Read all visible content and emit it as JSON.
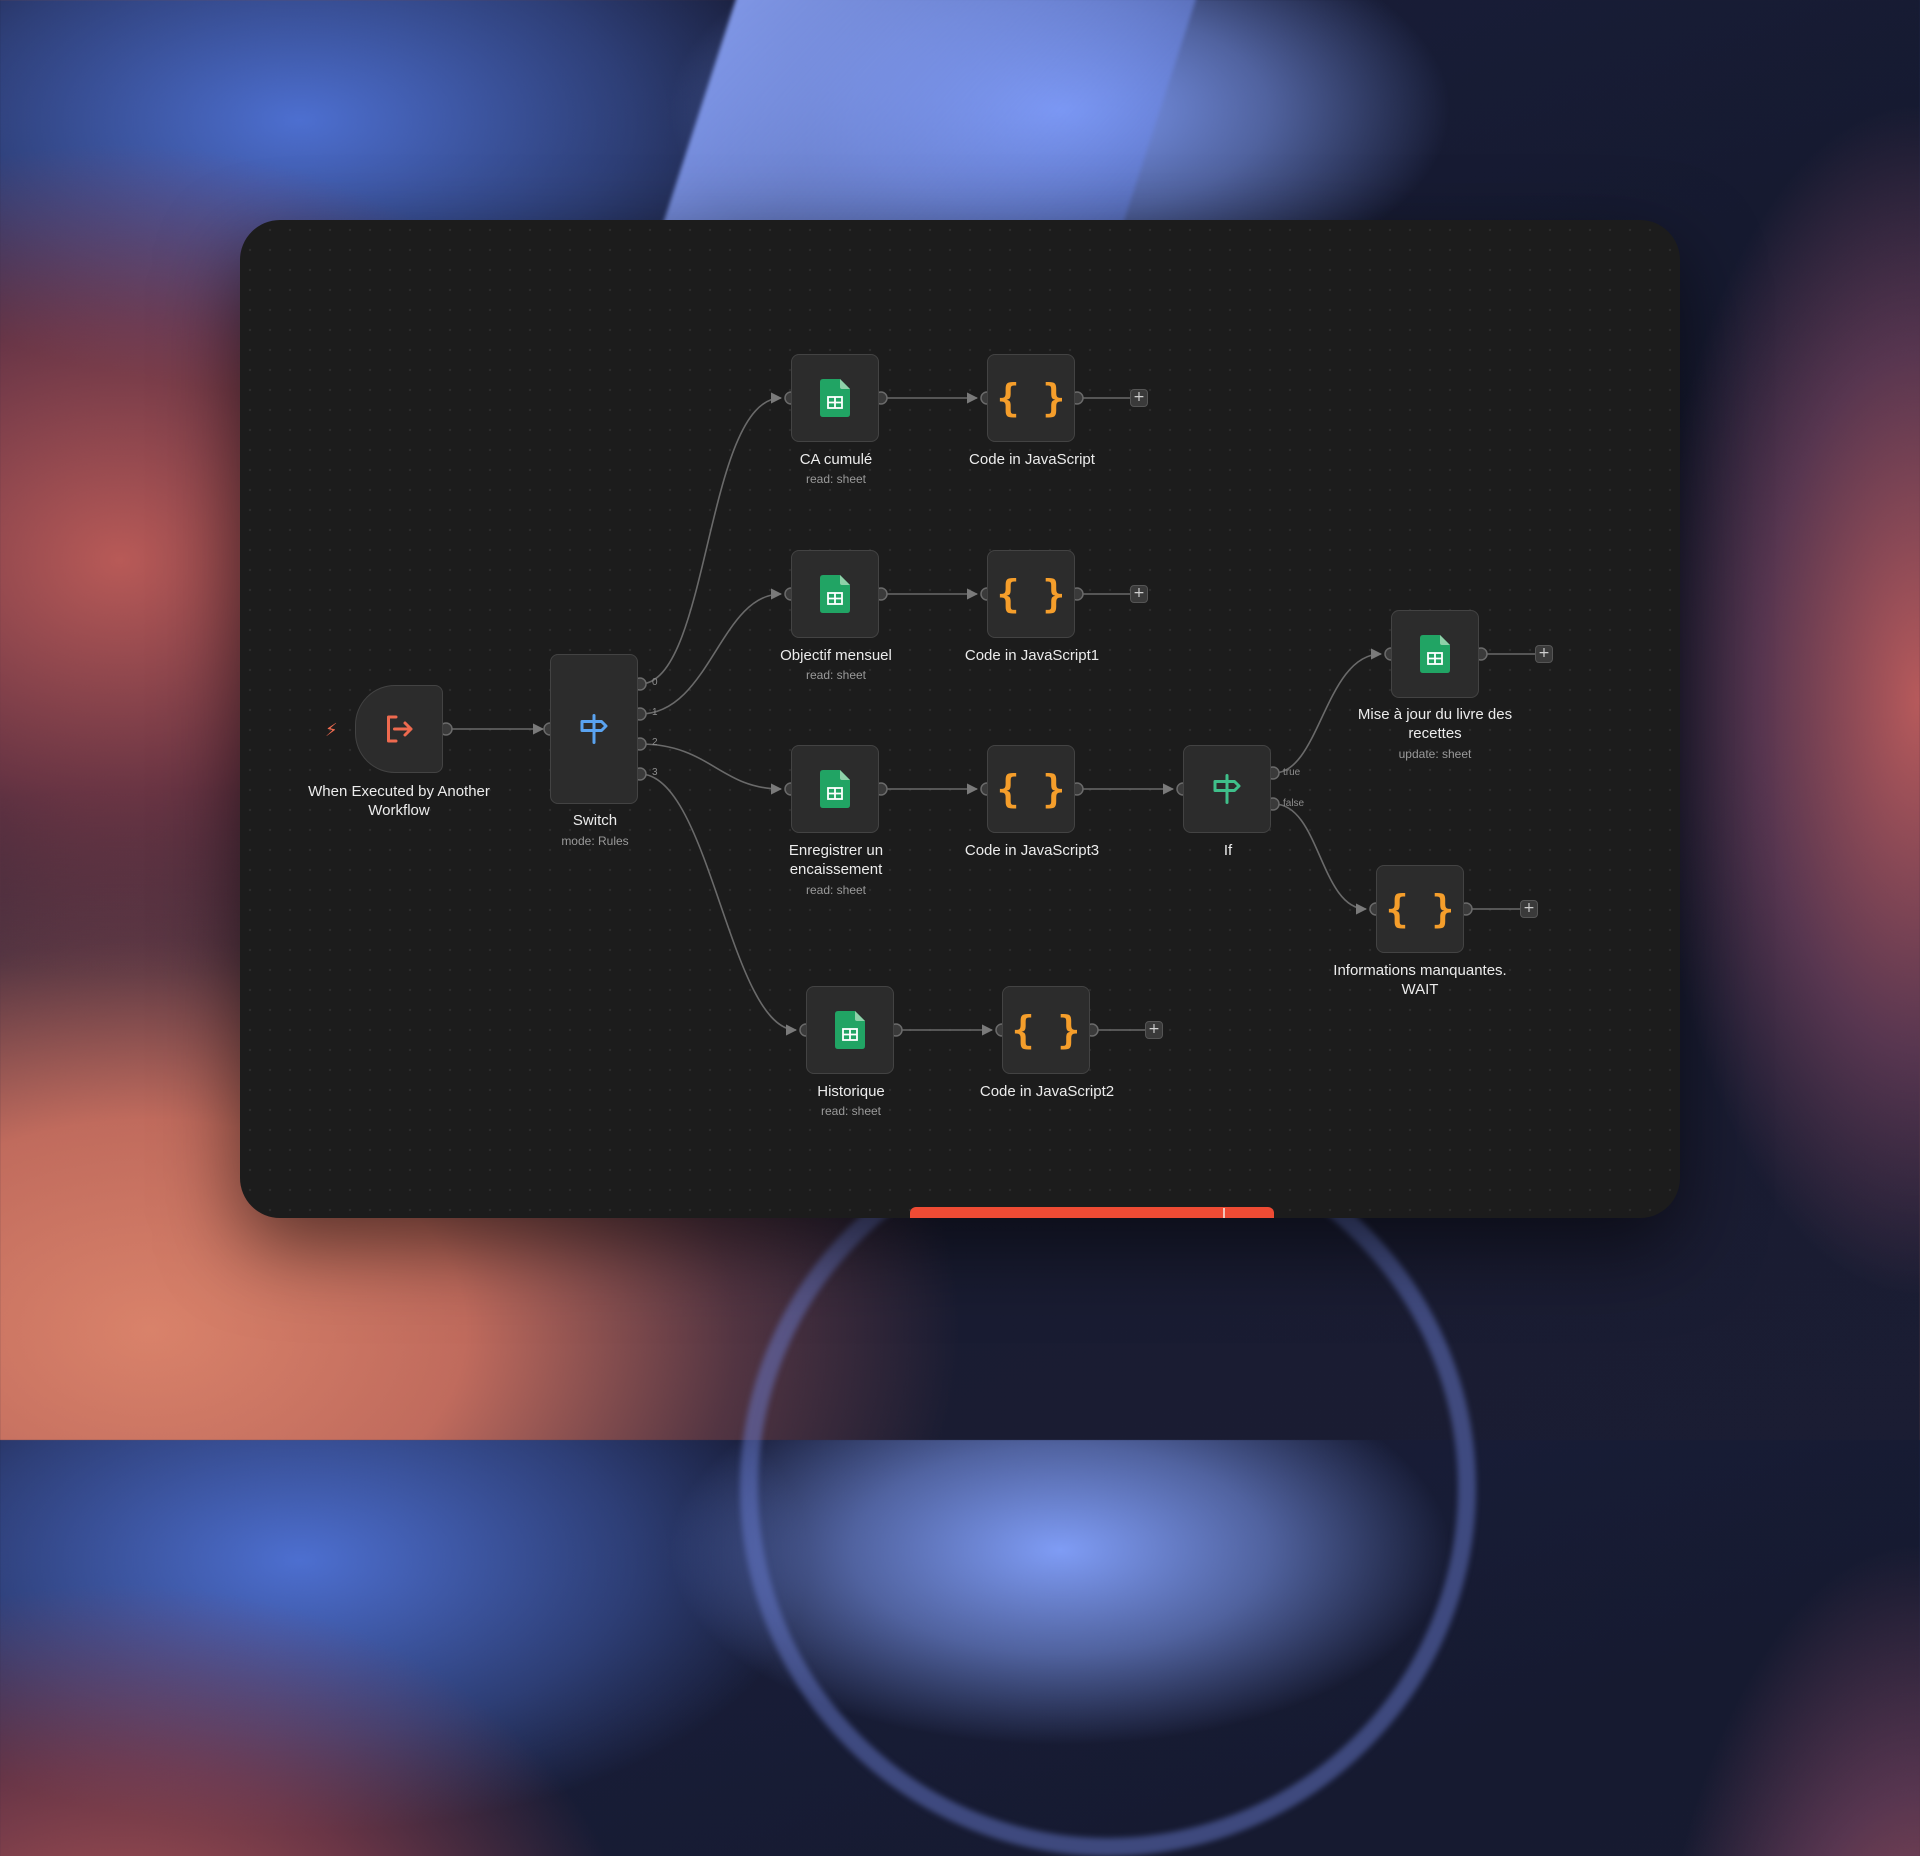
{
  "workflow": {
    "trigger": {
      "title": "When Executed by Another Workflow",
      "icon": "execute-workflow-trigger-icon",
      "bolt_icon": "lightning-bolt-icon",
      "color": "#ee6a4f"
    },
    "switch": {
      "title": "Switch",
      "subtitle": "mode: Rules",
      "icon": "signpost-icon",
      "color": "#5aa3f0",
      "outputs": [
        "0",
        "1",
        "2",
        "3"
      ]
    },
    "sheets": {
      "ca_cumule": {
        "title": "CA cumulé",
        "subtitle": "read: sheet"
      },
      "objectif_mensuel": {
        "title": "Objectif mensuel",
        "subtitle": "read: sheet"
      },
      "enregistrer": {
        "title": "Enregistrer un encaissement",
        "subtitle": "read: sheet"
      },
      "historique": {
        "title": "Historique",
        "subtitle": "read: sheet"
      },
      "mise_a_jour": {
        "title": "Mise à jour du livre des recettes",
        "subtitle": "update: sheet"
      },
      "icon": "google-sheets-icon",
      "color": "#21a464"
    },
    "code": {
      "js": {
        "title": "Code in JavaScript"
      },
      "js1": {
        "title": "Code in JavaScript1"
      },
      "js3": {
        "title": "Code in JavaScript3"
      },
      "js2": {
        "title": "Code in JavaScript2"
      },
      "wait": {
        "title": "Informations manquantes. WAIT"
      },
      "glyph": "{ }",
      "icon": "code-braces-icon",
      "color": "#f59e2b"
    },
    "if_node": {
      "title": "If",
      "icon": "signpost-icon",
      "color": "#3fbf8a",
      "outputs": {
        "true": "true",
        "false": "false"
      }
    },
    "add_button_label": "+"
  }
}
